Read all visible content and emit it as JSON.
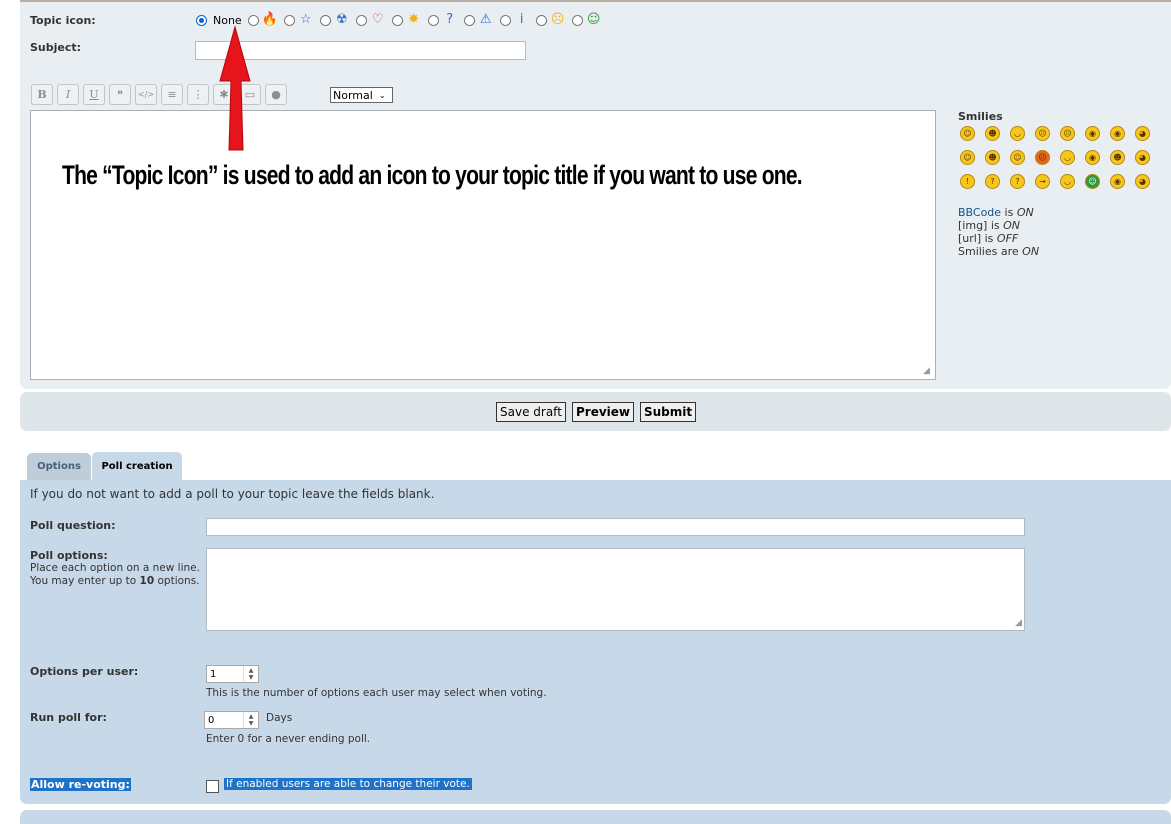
{
  "posting": {
    "topic_icon_label": "Topic icon:",
    "topic_icons": [
      {
        "label": "None",
        "icon": "none",
        "checked": true
      },
      {
        "icon": "fire-icon",
        "glyph": "🔥",
        "color": "#f08a24"
      },
      {
        "icon": "star-icon",
        "glyph": "☆",
        "color": "#2a6fc9"
      },
      {
        "icon": "radioactive-icon",
        "glyph": "☢",
        "color": "#2a6fc9"
      },
      {
        "icon": "heart-icon",
        "glyph": "♡",
        "color": "#d9302c"
      },
      {
        "icon": "lightbulb-icon",
        "glyph": "✸",
        "color": "#f2b21b"
      },
      {
        "icon": "question-icon",
        "glyph": "?",
        "color": "#2a6fc9"
      },
      {
        "icon": "warning-icon",
        "glyph": "⚠",
        "color": "#2a6fc9"
      },
      {
        "icon": "info-icon",
        "glyph": "i",
        "color": "#2a6fc9"
      },
      {
        "icon": "mad-face-icon",
        "glyph": "☹",
        "color": "#f2b21b"
      },
      {
        "icon": "alien-icon",
        "glyph": "☺",
        "color": "#2d9a3b"
      }
    ],
    "subject_label": "Subject:",
    "subject_value": "",
    "toolbar": {
      "buttons": [
        {
          "name": "bold-button",
          "glyph": "B"
        },
        {
          "name": "italic-button",
          "glyph": "I"
        },
        {
          "name": "underline-button",
          "glyph": "U"
        },
        {
          "name": "quote-button",
          "glyph": "❝"
        },
        {
          "name": "code-button",
          "glyph": "</>"
        },
        {
          "name": "list-button",
          "glyph": "≡"
        },
        {
          "name": "numbered-list-button",
          "glyph": "⋮"
        },
        {
          "name": "list-item-button",
          "glyph": "✱"
        },
        {
          "name": "image-button",
          "glyph": "▭"
        },
        {
          "name": "color-button",
          "glyph": "●"
        }
      ],
      "font_size_value": "Normal"
    },
    "annotation_text": "The “Topic Icon” is used to add an icon to your topic title if you want to use one.",
    "annotation_color": "#e8141b",
    "smilies_title": "Smilies",
    "smilies": [
      "☺",
      "☻",
      "◡",
      "☹",
      "☹",
      "◉",
      "◉",
      "◕",
      "☺",
      "☻",
      "☺",
      "☹",
      "◡",
      "◉",
      "☻",
      "◕",
      "!",
      "?",
      "?",
      "→",
      "◡",
      "☺",
      "◉",
      "◕"
    ],
    "bbcode_status": [
      {
        "link": "BBCode",
        "text": " is ",
        "state": "ON"
      },
      {
        "link": "",
        "text": "[img] is ",
        "state": "ON"
      },
      {
        "link": "",
        "text": "[url] is ",
        "state": "OFF"
      },
      {
        "link": "",
        "text": "Smilies are ",
        "state": "ON"
      }
    ]
  },
  "actions": {
    "save_draft": "Save draft",
    "preview": "Preview",
    "submit": "Submit"
  },
  "tabs": [
    {
      "label": "Options",
      "active": false
    },
    {
      "label": "Poll creation",
      "active": true
    }
  ],
  "poll": {
    "intro": "If you do not want to add a poll to your topic leave the fields blank.",
    "question_label": "Poll question:",
    "options_label": "Poll options:",
    "options_help_1": "Place each option on a new line. You may enter up to ",
    "options_help_max": "10",
    "options_help_2": " options.",
    "options_per_user_label": "Options per user:",
    "options_per_user_value": "1",
    "options_per_user_help": "This is the number of options each user may select when voting.",
    "run_poll_label": "Run poll for:",
    "run_poll_value": "0",
    "run_poll_unit": "Days",
    "run_poll_help": "Enter 0 for a never ending poll.",
    "revote_label": "Allow re-voting:",
    "revote_help": "If enabled users are able to change their vote."
  }
}
